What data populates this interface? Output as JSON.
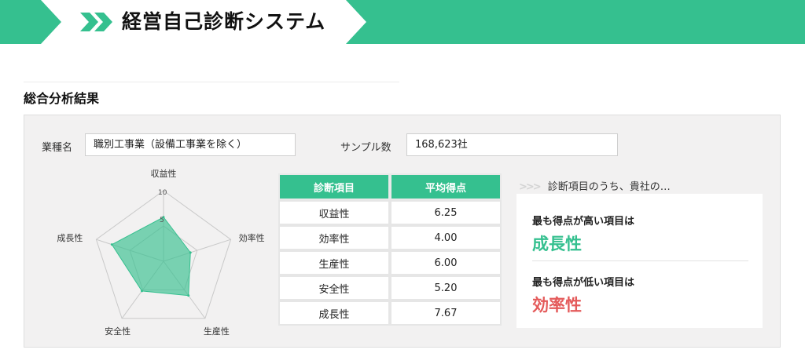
{
  "header": {
    "title": "経営自己診断システム",
    "accent_color": "#35c08f"
  },
  "section": {
    "title": "総合分析結果"
  },
  "form": {
    "industry_label": "業種名",
    "industry_value": "職別工事業（設備工事業を除く）",
    "sample_label": "サンプル数",
    "sample_value": "168,623社"
  },
  "chart_data": {
    "type": "radar",
    "axes": [
      "収益性",
      "効率性",
      "生産性",
      "安全性",
      "成長性"
    ],
    "values": [
      6.25,
      4.0,
      6.0,
      5.2,
      7.67
    ],
    "range": [
      0,
      10
    ],
    "ticks": [
      "5",
      "10"
    ],
    "fill_color": "#35c08f"
  },
  "table": {
    "headers": [
      "診断項目",
      "平均得点"
    ],
    "rows": [
      [
        "収益性",
        "6.25"
      ],
      [
        "効率性",
        "4.00"
      ],
      [
        "生産性",
        "6.00"
      ],
      [
        "安全性",
        "5.20"
      ],
      [
        "成長性",
        "7.67"
      ]
    ]
  },
  "result": {
    "heading": "診断項目のうち、貴社の…",
    "high_label": "最も得点が高い項目は",
    "high_value": "成長性",
    "high_color": "#35c08f",
    "low_label": "最も得点が低い項目は",
    "low_value": "効率性",
    "low_color": "#e45a5a"
  }
}
